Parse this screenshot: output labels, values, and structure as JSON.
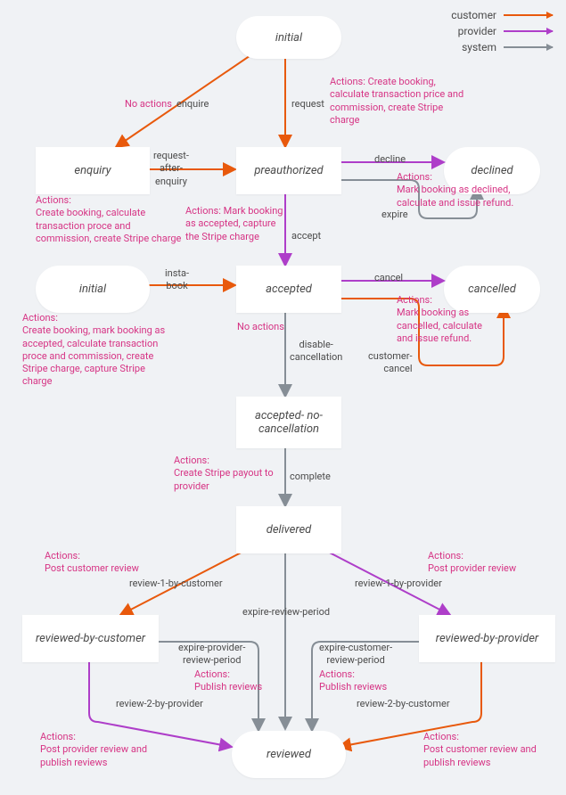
{
  "legend": {
    "customer": "customer",
    "provider": "provider",
    "system": "system"
  },
  "colors": {
    "customer": "#e8590c",
    "provider": "#ae3ec9",
    "system": "#868e96",
    "action_text": "#d63384"
  },
  "nodes": {
    "initial_top": "initial",
    "enquiry": "enquiry",
    "preauthorized": "preauthorized",
    "declined": "declined",
    "initial_left": "initial",
    "accepted": "accepted",
    "cancelled": "cancelled",
    "accepted_no_cancellation": "accepted-\nno-cancellation",
    "delivered": "delivered",
    "reviewed_by_customer": "reviewed-by-customer",
    "reviewed_by_provider": "reviewed-by-provider",
    "reviewed": "reviewed"
  },
  "transitions": {
    "enquire": "enquire",
    "request": "request",
    "request_after_enquiry": "request-\nafter-\nenquiry",
    "decline": "decline",
    "expire": "expire",
    "accept": "accept",
    "insta_book": "insta-\nbook",
    "cancel": "cancel",
    "customer_cancel": "customer-\ncancel",
    "disable_cancellation": "disable-\ncancellation",
    "complete": "complete",
    "review_1_by_customer": "review-1-by-customer",
    "review_1_by_provider": "review-1-by-provider",
    "expire_review_period": "expire-review-period",
    "expire_provider_review_period": "expire-provider-\nreview-period",
    "expire_customer_review_period": "expire-customer-\nreview-period",
    "review_2_by_provider": "review-2-by-provider",
    "review_2_by_customer": "review-2-by-customer"
  },
  "actions": {
    "no_actions_enquire": "No actions",
    "request_actions": "Actions: Create booking,\ncalculate transaction price and\ncommission, create Stripe\ncharge",
    "request_after_enquiry_actions": "Actions:\nCreate booking, calculate\ntransaction proce and\ncommission, create Stripe charge",
    "accept_actions": "Actions: Mark booking\nas accepted, capture\nthe Stripe charge",
    "decline_actions": "Actions:\nMark booking as declined,\ncalculate and issue refund.",
    "insta_book_actions": "Actions:\nCreate booking, mark booking as\naccepted, calculate transaction\nproce and commission, create\nStripe charge, capture Stripe\ncharge",
    "disable_cancel_actions": "No actions",
    "cancel_actions": "Actions:\nMark booking as\ncancelled, calculate\nand issue refund.",
    "complete_actions": "Actions:\nCreate Stripe payout to\nprovider",
    "review_1_customer_actions": "Actions:\nPost customer review",
    "review_1_provider_actions": "Actions:\nPost provider review",
    "expire_provider_actions": "Actions:\nPublish reviews",
    "expire_customer_actions": "Actions:\nPublish reviews",
    "review_2_provider_actions": "Actions:\nPost provider review and\npublish reviews",
    "review_2_customer_actions": "Actions:\nPost customer review and\npublish reviews"
  }
}
